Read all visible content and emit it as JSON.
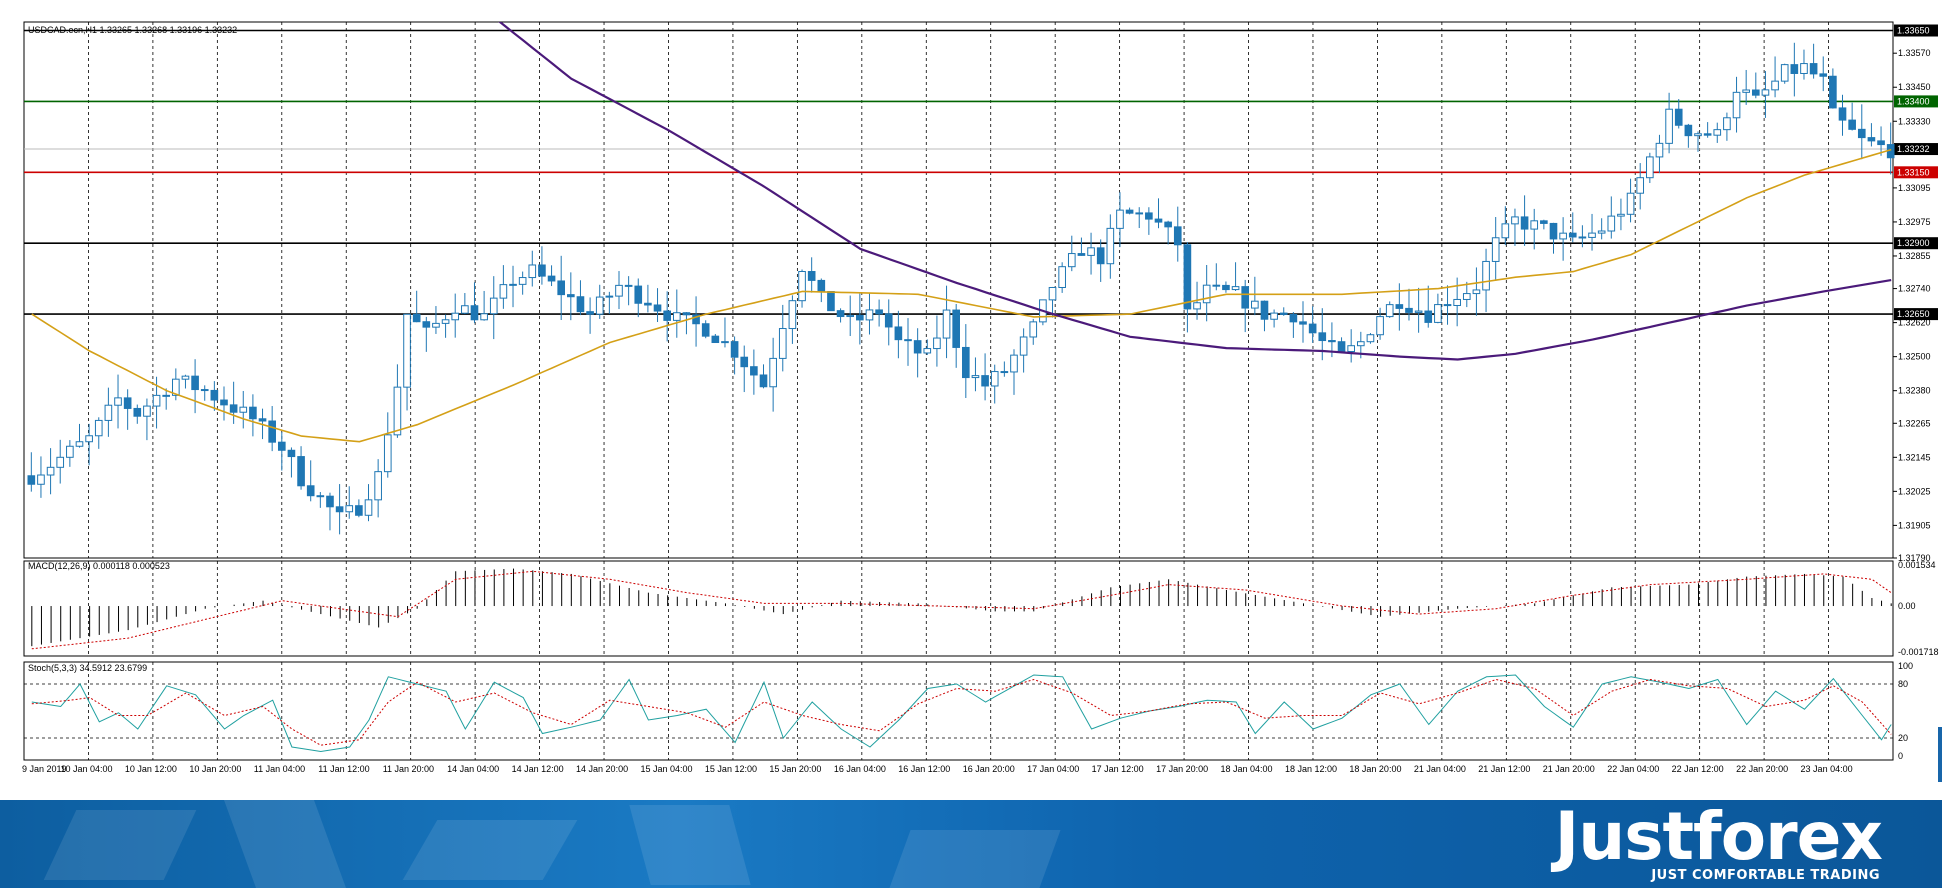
{
  "chart_header": "USDCAD.ecn,H1  1.33265 1.33268 1.33196 1.33232",
  "brand": {
    "name": "Justforex",
    "tagline": "JUST COMFORTABLE TRADING"
  },
  "colors": {
    "candle": "#1f77b4",
    "ma_fast": "#d4a017",
    "ma_slow": "#4b1a7a",
    "support_resistance": "#000000",
    "green_level": "#006400",
    "red_level": "#cc0000",
    "macd_signal": "#cc0000",
    "stoch_main": "#20a0a0",
    "stoch_signal": "#cc0000",
    "footer": "#0d5ea0"
  },
  "chart_data": [
    {
      "type": "candlestick",
      "name": "USDCAD.ecn,H1",
      "ylim": [
        1.3179,
        1.3368
      ],
      "x_tick_labels": [
        "9 Jan 2019",
        "10 Jan 04:00",
        "10 Jan 12:00",
        "10 Jan 20:00",
        "11 Jan 04:00",
        "11 Jan 12:00",
        "11 Jan 20:00",
        "14 Jan 04:00",
        "14 Jan 12:00",
        "14 Jan 20:00",
        "15 Jan 04:00",
        "15 Jan 12:00",
        "15 Jan 20:00",
        "16 Jan 04:00",
        "16 Jan 12:00",
        "16 Jan 20:00",
        "17 Jan 04:00",
        "17 Jan 12:00",
        "17 Jan 20:00",
        "18 Jan 04:00",
        "18 Jan 12:00",
        "18 Jan 20:00",
        "21 Jan 04:00",
        "21 Jan 12:00",
        "21 Jan 20:00",
        "22 Jan 04:00",
        "22 Jan 12:00",
        "22 Jan 20:00",
        "23 Jan 04:00"
      ],
      "y_tick_labels": [
        "1.33570",
        "1.33450",
        "1.33330",
        "1.33095",
        "1.32975",
        "1.32855",
        "1.32740",
        "1.32620",
        "1.32500",
        "1.32380",
        "1.32265",
        "1.32145",
        "1.32025",
        "1.31905",
        "1.31790"
      ],
      "y_ticks": [
        1.3357,
        1.3345,
        1.3333,
        1.33095,
        1.32975,
        1.32855,
        1.3274,
        1.3262,
        1.325,
        1.3238,
        1.32265,
        1.32145,
        1.32025,
        1.31905,
        1.3179
      ],
      "horizontal_levels": [
        {
          "label": "1.33650",
          "value": 1.3365,
          "color": "#000000"
        },
        {
          "label": "1.33400",
          "value": 1.334,
          "color": "#006400"
        },
        {
          "label": "1.33232",
          "value": 1.33232,
          "color": "#000000"
        },
        {
          "label": "1.33150",
          "value": 1.3315,
          "color": "#cc0000"
        },
        {
          "label": "1.32900",
          "value": 1.329,
          "color": "#000000"
        },
        {
          "label": "1.32650",
          "value": 1.3265,
          "color": "#000000"
        }
      ],
      "close_anchors": [
        [
          0,
          1.3208
        ],
        [
          2,
          1.3212
        ],
        [
          6,
          1.3221
        ],
        [
          9,
          1.3235
        ],
        [
          11,
          1.323
        ],
        [
          15,
          1.3242
        ],
        [
          18,
          1.3238
        ],
        [
          21,
          1.3232
        ],
        [
          23,
          1.3228
        ],
        [
          26,
          1.3218
        ],
        [
          28,
          1.3207
        ],
        [
          30,
          1.32
        ],
        [
          32,
          1.3193
        ],
        [
          34,
          1.3197
        ],
        [
          36,
          1.3208
        ],
        [
          38,
          1.324
        ],
        [
          39,
          1.3265
        ],
        [
          41,
          1.3258
        ],
        [
          44,
          1.3268
        ],
        [
          47,
          1.3264
        ],
        [
          50,
          1.3277
        ],
        [
          52,
          1.328
        ],
        [
          55,
          1.3273
        ],
        [
          58,
          1.3265
        ],
        [
          61,
          1.3275
        ],
        [
          64,
          1.327
        ],
        [
          67,
          1.3263
        ],
        [
          70,
          1.326
        ],
        [
          73,
          1.3252
        ],
        [
          76,
          1.324
        ],
        [
          78,
          1.3262
        ],
        [
          80,
          1.3282
        ],
        [
          82,
          1.327
        ],
        [
          85,
          1.3262
        ],
        [
          88,
          1.3266
        ],
        [
          90,
          1.3255
        ],
        [
          93,
          1.325
        ],
        [
          95,
          1.3265
        ],
        [
          97,
          1.3245
        ],
        [
          99,
          1.324
        ],
        [
          101,
          1.3245
        ],
        [
          104,
          1.326
        ],
        [
          106,
          1.3275
        ],
        [
          109,
          1.3288
        ],
        [
          111,
          1.3285
        ],
        [
          113,
          1.33
        ],
        [
          116,
          1.33
        ],
        [
          119,
          1.329
        ],
        [
          120,
          1.3265
        ],
        [
          122,
          1.3273
        ],
        [
          125,
          1.3272
        ],
        [
          128,
          1.3265
        ],
        [
          131,
          1.3265
        ],
        [
          134,
          1.3255
        ],
        [
          136,
          1.325
        ],
        [
          138,
          1.3255
        ],
        [
          140,
          1.3265
        ],
        [
          142,
          1.327
        ],
        [
          145,
          1.3265
        ],
        [
          147,
          1.327
        ],
        [
          150,
          1.3275
        ],
        [
          152,
          1.329
        ],
        [
          154,
          1.3298
        ],
        [
          157,
          1.3295
        ],
        [
          160,
          1.329
        ],
        [
          163,
          1.3295
        ],
        [
          166,
          1.3305
        ],
        [
          168,
          1.332
        ],
        [
          170,
          1.3335
        ],
        [
          172,
          1.333
        ],
        [
          175,
          1.3328
        ],
        [
          177,
          1.3345
        ],
        [
          179,
          1.334
        ],
        [
          182,
          1.335
        ],
        [
          184,
          1.3352
        ],
        [
          186,
          1.3347
        ],
        [
          187,
          1.3335
        ],
        [
          190,
          1.3326
        ],
        [
          193,
          1.3323
        ]
      ],
      "ma_fast_anchors": [
        [
          0,
          1.3265
        ],
        [
          6,
          1.3252
        ],
        [
          14,
          1.3238
        ],
        [
          22,
          1.3228
        ],
        [
          28,
          1.3222
        ],
        [
          34,
          1.322
        ],
        [
          40,
          1.3226
        ],
        [
          50,
          1.324
        ],
        [
          60,
          1.3255
        ],
        [
          70,
          1.3265
        ],
        [
          80,
          1.3273
        ],
        [
          92,
          1.3272
        ],
        [
          104,
          1.3264
        ],
        [
          114,
          1.3265
        ],
        [
          124,
          1.3272
        ],
        [
          136,
          1.3272
        ],
        [
          146,
          1.3274
        ],
        [
          154,
          1.3278
        ],
        [
          160,
          1.328
        ],
        [
          166,
          1.3286
        ],
        [
          172,
          1.3296
        ],
        [
          178,
          1.3306
        ],
        [
          184,
          1.3314
        ],
        [
          190,
          1.332
        ],
        [
          193,
          1.3323
        ]
      ],
      "ma_slow_anchors": [
        [
          46,
          1.3375
        ],
        [
          56,
          1.3348
        ],
        [
          66,
          1.333
        ],
        [
          76,
          1.331
        ],
        [
          86,
          1.3288
        ],
        [
          96,
          1.3276
        ],
        [
          106,
          1.3265
        ],
        [
          114,
          1.3257
        ],
        [
          124,
          1.3253
        ],
        [
          134,
          1.3252
        ],
        [
          142,
          1.325
        ],
        [
          148,
          1.3249
        ],
        [
          154,
          1.3251
        ],
        [
          162,
          1.3256
        ],
        [
          170,
          1.3262
        ],
        [
          178,
          1.3268
        ],
        [
          186,
          1.3273
        ],
        [
          193,
          1.3277
        ]
      ]
    },
    {
      "type": "bar",
      "name": "MACD(12,26,9) 0.000118 0.000523",
      "ylim": [
        -0.001718,
        0.001534
      ],
      "y_tick_labels": [
        "0.001534",
        "0.00",
        "-0.001718"
      ],
      "y_ticks": [
        0.001534,
        0.0,
        -0.001718
      ],
      "macd_anchors": [
        [
          0,
          -0.0015
        ],
        [
          10,
          -0.0009
        ],
        [
          18,
          -0.0001
        ],
        [
          24,
          0.0002
        ],
        [
          30,
          -0.0003
        ],
        [
          36,
          -0.0008
        ],
        [
          40,
          -0.0001
        ],
        [
          44,
          0.0013
        ],
        [
          50,
          0.0014
        ],
        [
          56,
          0.0012
        ],
        [
          64,
          0.0005
        ],
        [
          72,
          0.0001
        ],
        [
          78,
          -0.0003
        ],
        [
          84,
          0.0002
        ],
        [
          92,
          0.0001
        ],
        [
          100,
          -0.0002
        ],
        [
          104,
          -0.0002
        ],
        [
          112,
          0.0007
        ],
        [
          118,
          0.001
        ],
        [
          124,
          0.0006
        ],
        [
          132,
          0.0001
        ],
        [
          140,
          -0.0004
        ],
        [
          148,
          -0.0001
        ],
        [
          156,
          0.0001
        ],
        [
          164,
          0.0007
        ],
        [
          172,
          0.0008
        ],
        [
          178,
          0.0011
        ],
        [
          184,
          0.0012
        ],
        [
          188,
          0.0011
        ],
        [
          191,
          0.0003
        ],
        [
          193,
          0.0001
        ]
      ],
      "signal_anchors": [
        [
          0,
          -0.0016
        ],
        [
          10,
          -0.0012
        ],
        [
          18,
          -0.0005
        ],
        [
          26,
          0.0002
        ],
        [
          32,
          -0.0001
        ],
        [
          38,
          -0.0004
        ],
        [
          44,
          0.001
        ],
        [
          52,
          0.0013
        ],
        [
          60,
          0.001
        ],
        [
          68,
          0.0005
        ],
        [
          76,
          0.0001
        ],
        [
          84,
          0.0001
        ],
        [
          94,
          0.0
        ],
        [
          104,
          -0.0001
        ],
        [
          112,
          0.0004
        ],
        [
          118,
          0.0008
        ],
        [
          126,
          0.0006
        ],
        [
          136,
          0.0
        ],
        [
          144,
          -0.0003
        ],
        [
          152,
          -0.0001
        ],
        [
          160,
          0.0004
        ],
        [
          168,
          0.0008
        ],
        [
          178,
          0.001
        ],
        [
          186,
          0.0012
        ],
        [
          191,
          0.001
        ],
        [
          193,
          0.0005
        ]
      ]
    },
    {
      "type": "line",
      "name": "Stoch(5,3,3) 34.5912 23.6799",
      "ylim": [
        0,
        100
      ],
      "y_tick_labels": [
        "100",
        "80",
        "20",
        "0"
      ],
      "y_ticks": [
        100,
        80,
        20,
        0
      ],
      "main_anchors": [
        [
          0,
          60
        ],
        [
          3,
          55
        ],
        [
          5,
          80
        ],
        [
          7,
          38
        ],
        [
          9,
          48
        ],
        [
          11,
          30
        ],
        [
          14,
          78
        ],
        [
          17,
          68
        ],
        [
          20,
          30
        ],
        [
          22,
          45
        ],
        [
          25,
          62
        ],
        [
          27,
          10
        ],
        [
          30,
          5
        ],
        [
          33,
          10
        ],
        [
          35,
          40
        ],
        [
          37,
          88
        ],
        [
          40,
          80
        ],
        [
          43,
          72
        ],
        [
          45,
          30
        ],
        [
          48,
          82
        ],
        [
          51,
          65
        ],
        [
          53,
          25
        ],
        [
          56,
          32
        ],
        [
          59,
          40
        ],
        [
          62,
          85
        ],
        [
          64,
          40
        ],
        [
          67,
          45
        ],
        [
          70,
          52
        ],
        [
          73,
          15
        ],
        [
          76,
          82
        ],
        [
          78,
          20
        ],
        [
          81,
          60
        ],
        [
          84,
          30
        ],
        [
          87,
          10
        ],
        [
          90,
          40
        ],
        [
          93,
          75
        ],
        [
          96,
          80
        ],
        [
          99,
          60
        ],
        [
          102,
          78
        ],
        [
          104,
          90
        ],
        [
          107,
          88
        ],
        [
          110,
          30
        ],
        [
          113,
          42
        ],
        [
          116,
          50
        ],
        [
          119,
          55
        ],
        [
          122,
          62
        ],
        [
          125,
          60
        ],
        [
          127,
          25
        ],
        [
          130,
          60
        ],
        [
          133,
          30
        ],
        [
          136,
          42
        ],
        [
          139,
          68
        ],
        [
          142,
          80
        ],
        [
          145,
          35
        ],
        [
          148,
          72
        ],
        [
          151,
          88
        ],
        [
          154,
          90
        ],
        [
          157,
          55
        ],
        [
          160,
          32
        ],
        [
          163,
          80
        ],
        [
          166,
          88
        ],
        [
          169,
          82
        ],
        [
          172,
          75
        ],
        [
          175,
          85
        ],
        [
          178,
          35
        ],
        [
          181,
          72
        ],
        [
          184,
          52
        ],
        [
          187,
          86
        ],
        [
          190,
          45
        ],
        [
          192,
          18
        ],
        [
          193,
          35
        ]
      ],
      "signal_anchors": [
        [
          0,
          58
        ],
        [
          4,
          62
        ],
        [
          6,
          65
        ],
        [
          9,
          45
        ],
        [
          12,
          45
        ],
        [
          16,
          70
        ],
        [
          20,
          45
        ],
        [
          24,
          55
        ],
        [
          27,
          30
        ],
        [
          30,
          12
        ],
        [
          34,
          18
        ],
        [
          37,
          60
        ],
        [
          40,
          82
        ],
        [
          44,
          60
        ],
        [
          48,
          70
        ],
        [
          52,
          48
        ],
        [
          56,
          35
        ],
        [
          60,
          62
        ],
        [
          64,
          55
        ],
        [
          68,
          48
        ],
        [
          72,
          32
        ],
        [
          76,
          60
        ],
        [
          80,
          45
        ],
        [
          84,
          35
        ],
        [
          88,
          28
        ],
        [
          92,
          58
        ],
        [
          96,
          75
        ],
        [
          100,
          72
        ],
        [
          104,
          85
        ],
        [
          108,
          70
        ],
        [
          112,
          45
        ],
        [
          116,
          50
        ],
        [
          120,
          58
        ],
        [
          124,
          60
        ],
        [
          128,
          42
        ],
        [
          132,
          45
        ],
        [
          136,
          45
        ],
        [
          140,
          70
        ],
        [
          144,
          58
        ],
        [
          148,
          70
        ],
        [
          152,
          85
        ],
        [
          156,
          75
        ],
        [
          160,
          45
        ],
        [
          164,
          72
        ],
        [
          168,
          85
        ],
        [
          172,
          78
        ],
        [
          176,
          75
        ],
        [
          180,
          55
        ],
        [
          184,
          62
        ],
        [
          187,
          78
        ],
        [
          190,
          60
        ],
        [
          193,
          24
        ]
      ]
    }
  ]
}
